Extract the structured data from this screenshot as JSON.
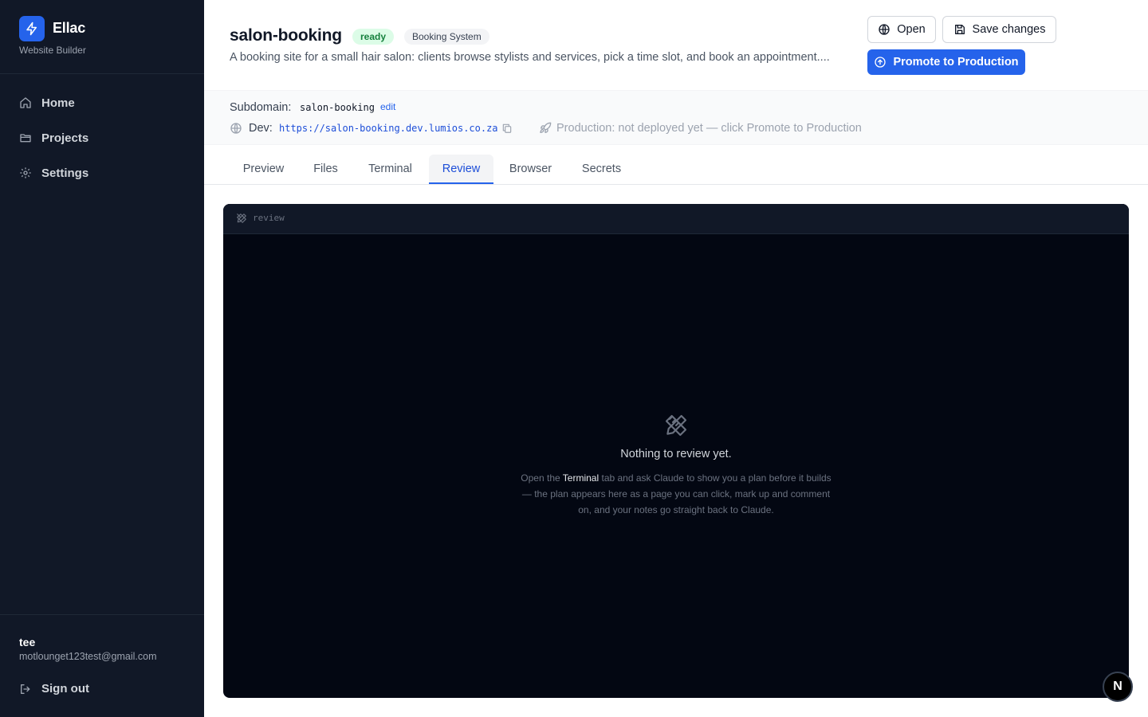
{
  "app": {
    "name": "Ellac",
    "subtitle": "Website Builder",
    "accent": "#2563eb"
  },
  "sidebar": {
    "items": [
      {
        "label": "Home",
        "icon": "home-icon"
      },
      {
        "label": "Projects",
        "icon": "folder-icon"
      },
      {
        "label": "Settings",
        "icon": "gear-icon"
      }
    ],
    "user": {
      "name": "tee",
      "email": "motlounget123test@gmail.com"
    },
    "signout_label": "Sign out"
  },
  "project": {
    "name": "salon-booking",
    "status": "ready",
    "category": "Booking System",
    "description": "A booking site for a small hair salon: clients browse stylists and services, pick a time slot, and book an appointment...."
  },
  "actions": {
    "open": "Open",
    "save": "Save changes",
    "promote": "Promote to Production"
  },
  "info": {
    "subdomain_label": "Subdomain:",
    "subdomain": "salon-booking",
    "edit_label": "edit",
    "dev_label": "Dev:",
    "dev_url": "https://salon-booking.dev.lumios.co.za",
    "production_text": "Production: not deployed yet — click Promote to Production"
  },
  "tabs": [
    {
      "label": "Preview",
      "active": false
    },
    {
      "label": "Files",
      "active": false
    },
    {
      "label": "Terminal",
      "active": false
    },
    {
      "label": "Review",
      "active": true
    },
    {
      "label": "Browser",
      "active": false
    },
    {
      "label": "Secrets",
      "active": false
    }
  ],
  "panel": {
    "header_label": "review",
    "empty_title": "Nothing to review yet.",
    "empty_body_pre": "Open the ",
    "empty_body_highlight": "Terminal",
    "empty_body_post": " tab and ask Claude to show you a plan before it builds — the plan appears here as a page you can click, mark up and comment on, and your notes go straight back to Claude."
  },
  "fab_label": "N"
}
